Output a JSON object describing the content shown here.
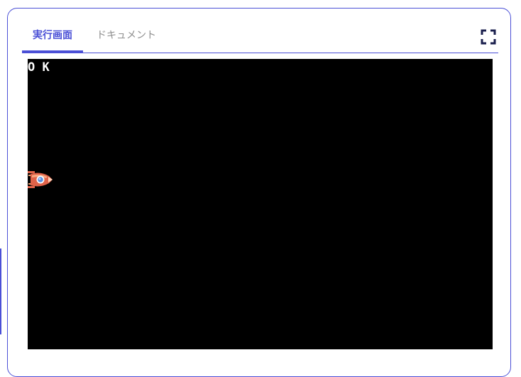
{
  "tabs": [
    {
      "label": "実行画面",
      "active": true
    },
    {
      "label": "ドキュメント",
      "active": false
    }
  ],
  "icons": {
    "fullscreen": "fullscreen-icon",
    "sprite": "spaceship-sprite"
  },
  "screen": {
    "output_text": "O K"
  },
  "colors": {
    "accent": "#4a4fd6",
    "inactive_tab": "#8f8f8f",
    "screen_bg": "#000000",
    "screen_text": "#ffffff",
    "ship_body": "#e0634a"
  }
}
